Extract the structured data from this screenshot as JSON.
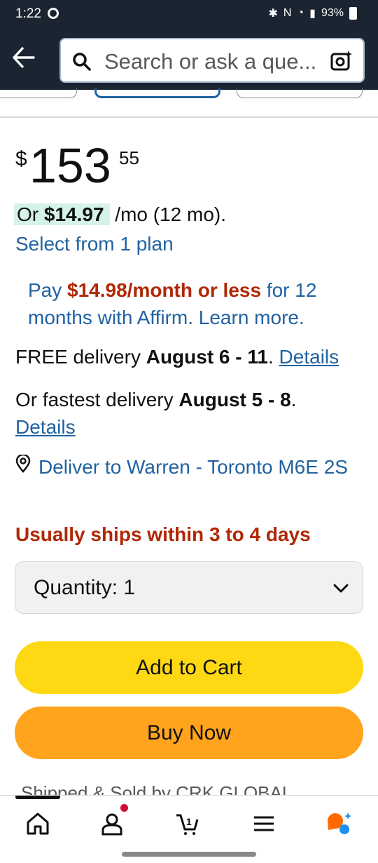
{
  "status_bar": {
    "time": "1:22",
    "battery": "93%"
  },
  "header": {
    "search_placeholder": "Search or ask a que..."
  },
  "price": {
    "currency": "$",
    "whole": "153",
    "fraction": "55"
  },
  "monthly": {
    "prefix": "Or ",
    "amount": "$14.97",
    "suffix": " /mo (12 mo).",
    "plan_link": "Select from 1 plan"
  },
  "affirm": {
    "pay": "Pay ",
    "amount": "$14.98/month or less",
    "rest": " for 12 months with Affirm. Learn more."
  },
  "delivery": {
    "free_prefix": "FREE delivery ",
    "free_dates": "August 6 - 11",
    "free_dot": ". ",
    "free_details": "Details",
    "fast_prefix": "Or fastest delivery ",
    "fast_dates": "August 5 - 8",
    "fast_dot": ".",
    "fast_details": "Details"
  },
  "location": {
    "text": "Deliver to Warren - Toronto M6E 2S"
  },
  "availability": "Usually ships within 3 to 4 days",
  "quantity": {
    "label": "Quantity: 1"
  },
  "buttons": {
    "add_to_cart": "Add to Cart",
    "buy_now": "Buy Now"
  },
  "seller": {
    "text": "Shipped & Sold by  CRK GLOBAL"
  },
  "colors": {
    "header_bg": "#1b2431",
    "link": "#2162a1",
    "price_red": "#b12704",
    "cart_yellow": "#ffd814",
    "buy_orange": "#ffa41c"
  },
  "nav_icons": [
    "home-icon",
    "account-icon",
    "cart-icon",
    "menu-icon",
    "rufus-icon"
  ],
  "cart_count": "1"
}
